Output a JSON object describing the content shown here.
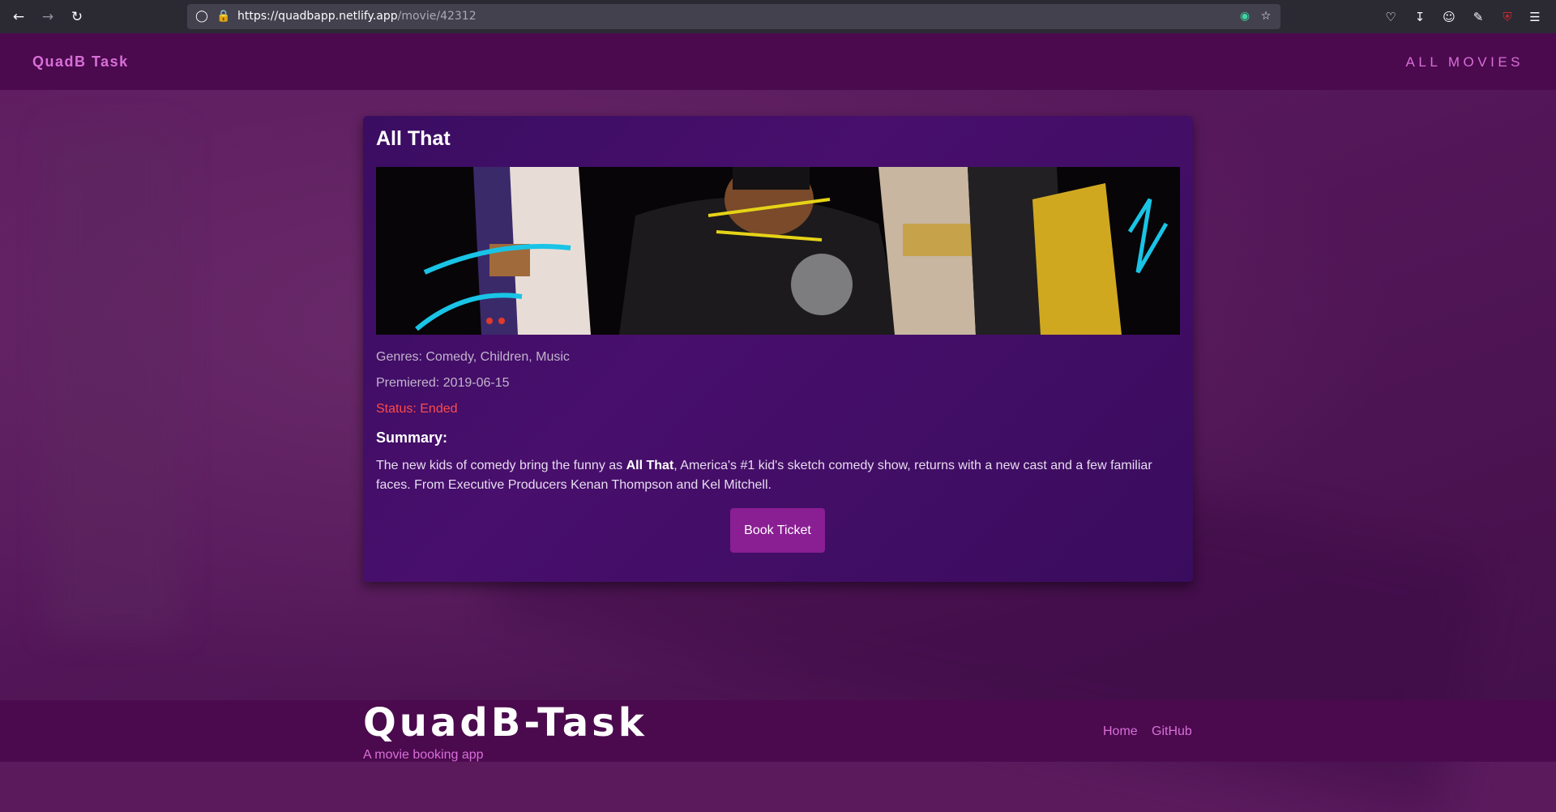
{
  "browser": {
    "url_host": "https://quadbapp.netlify.app",
    "url_path": "/movie/42312"
  },
  "navbar": {
    "brand": "QuadB Task",
    "all_movies_link": "ALL MOVIES"
  },
  "movie": {
    "title": "All That",
    "genres": "Genres: Comedy, Children, Music",
    "premiered": "Premiered: 2019-06-15",
    "status": "Status: Ended",
    "summary_heading": "Summary:",
    "summary_prefix": "The new kids of comedy bring the funny as ",
    "summary_bold": "All That",
    "summary_suffix": ", America's #1 kid's sketch comedy show, returns with a new cast and a few familiar faces. From Executive Producers Kenan Thompson and Kel Mitchell.",
    "book_button": "Book Ticket"
  },
  "footer": {
    "title": "QuadB-Task",
    "subtitle": "A movie booking app",
    "links": [
      "Home",
      "GitHub"
    ]
  },
  "colors": {
    "navbar_bg": "#4b0a4e",
    "accent": "#d86fd8",
    "status": "#ff4a4a",
    "button": "#8a1e93"
  }
}
